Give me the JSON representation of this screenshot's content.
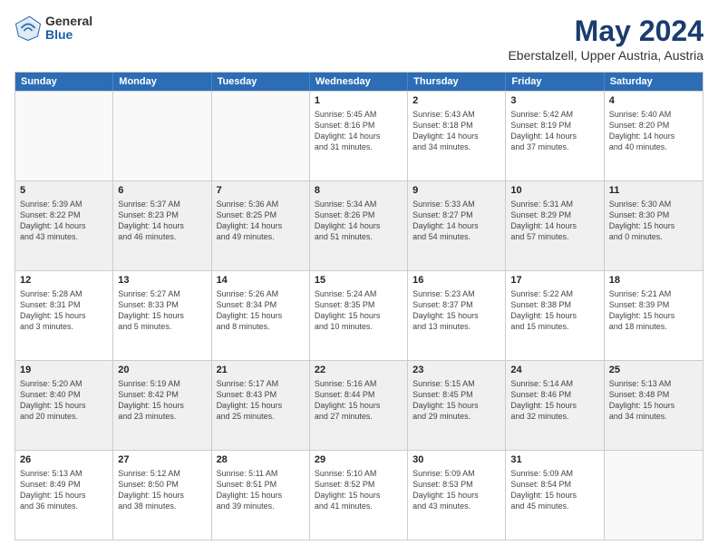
{
  "logo": {
    "general": "General",
    "blue": "Blue"
  },
  "title": "May 2024",
  "subtitle": "Eberstalzell, Upper Austria, Austria",
  "weekdays": [
    "Sunday",
    "Monday",
    "Tuesday",
    "Wednesday",
    "Thursday",
    "Friday",
    "Saturday"
  ],
  "weeks": [
    [
      {
        "day": "",
        "info": ""
      },
      {
        "day": "",
        "info": ""
      },
      {
        "day": "",
        "info": ""
      },
      {
        "day": "1",
        "info": "Sunrise: 5:45 AM\nSunset: 8:16 PM\nDaylight: 14 hours\nand 31 minutes."
      },
      {
        "day": "2",
        "info": "Sunrise: 5:43 AM\nSunset: 8:18 PM\nDaylight: 14 hours\nand 34 minutes."
      },
      {
        "day": "3",
        "info": "Sunrise: 5:42 AM\nSunset: 8:19 PM\nDaylight: 14 hours\nand 37 minutes."
      },
      {
        "day": "4",
        "info": "Sunrise: 5:40 AM\nSunset: 8:20 PM\nDaylight: 14 hours\nand 40 minutes."
      }
    ],
    [
      {
        "day": "5",
        "info": "Sunrise: 5:39 AM\nSunset: 8:22 PM\nDaylight: 14 hours\nand 43 minutes."
      },
      {
        "day": "6",
        "info": "Sunrise: 5:37 AM\nSunset: 8:23 PM\nDaylight: 14 hours\nand 46 minutes."
      },
      {
        "day": "7",
        "info": "Sunrise: 5:36 AM\nSunset: 8:25 PM\nDaylight: 14 hours\nand 49 minutes."
      },
      {
        "day": "8",
        "info": "Sunrise: 5:34 AM\nSunset: 8:26 PM\nDaylight: 14 hours\nand 51 minutes."
      },
      {
        "day": "9",
        "info": "Sunrise: 5:33 AM\nSunset: 8:27 PM\nDaylight: 14 hours\nand 54 minutes."
      },
      {
        "day": "10",
        "info": "Sunrise: 5:31 AM\nSunset: 8:29 PM\nDaylight: 14 hours\nand 57 minutes."
      },
      {
        "day": "11",
        "info": "Sunrise: 5:30 AM\nSunset: 8:30 PM\nDaylight: 15 hours\nand 0 minutes."
      }
    ],
    [
      {
        "day": "12",
        "info": "Sunrise: 5:28 AM\nSunset: 8:31 PM\nDaylight: 15 hours\nand 3 minutes."
      },
      {
        "day": "13",
        "info": "Sunrise: 5:27 AM\nSunset: 8:33 PM\nDaylight: 15 hours\nand 5 minutes."
      },
      {
        "day": "14",
        "info": "Sunrise: 5:26 AM\nSunset: 8:34 PM\nDaylight: 15 hours\nand 8 minutes."
      },
      {
        "day": "15",
        "info": "Sunrise: 5:24 AM\nSunset: 8:35 PM\nDaylight: 15 hours\nand 10 minutes."
      },
      {
        "day": "16",
        "info": "Sunrise: 5:23 AM\nSunset: 8:37 PM\nDaylight: 15 hours\nand 13 minutes."
      },
      {
        "day": "17",
        "info": "Sunrise: 5:22 AM\nSunset: 8:38 PM\nDaylight: 15 hours\nand 15 minutes."
      },
      {
        "day": "18",
        "info": "Sunrise: 5:21 AM\nSunset: 8:39 PM\nDaylight: 15 hours\nand 18 minutes."
      }
    ],
    [
      {
        "day": "19",
        "info": "Sunrise: 5:20 AM\nSunset: 8:40 PM\nDaylight: 15 hours\nand 20 minutes."
      },
      {
        "day": "20",
        "info": "Sunrise: 5:19 AM\nSunset: 8:42 PM\nDaylight: 15 hours\nand 23 minutes."
      },
      {
        "day": "21",
        "info": "Sunrise: 5:17 AM\nSunset: 8:43 PM\nDaylight: 15 hours\nand 25 minutes."
      },
      {
        "day": "22",
        "info": "Sunrise: 5:16 AM\nSunset: 8:44 PM\nDaylight: 15 hours\nand 27 minutes."
      },
      {
        "day": "23",
        "info": "Sunrise: 5:15 AM\nSunset: 8:45 PM\nDaylight: 15 hours\nand 29 minutes."
      },
      {
        "day": "24",
        "info": "Sunrise: 5:14 AM\nSunset: 8:46 PM\nDaylight: 15 hours\nand 32 minutes."
      },
      {
        "day": "25",
        "info": "Sunrise: 5:13 AM\nSunset: 8:48 PM\nDaylight: 15 hours\nand 34 minutes."
      }
    ],
    [
      {
        "day": "26",
        "info": "Sunrise: 5:13 AM\nSunset: 8:49 PM\nDaylight: 15 hours\nand 36 minutes."
      },
      {
        "day": "27",
        "info": "Sunrise: 5:12 AM\nSunset: 8:50 PM\nDaylight: 15 hours\nand 38 minutes."
      },
      {
        "day": "28",
        "info": "Sunrise: 5:11 AM\nSunset: 8:51 PM\nDaylight: 15 hours\nand 39 minutes."
      },
      {
        "day": "29",
        "info": "Sunrise: 5:10 AM\nSunset: 8:52 PM\nDaylight: 15 hours\nand 41 minutes."
      },
      {
        "day": "30",
        "info": "Sunrise: 5:09 AM\nSunset: 8:53 PM\nDaylight: 15 hours\nand 43 minutes."
      },
      {
        "day": "31",
        "info": "Sunrise: 5:09 AM\nSunset: 8:54 PM\nDaylight: 15 hours\nand 45 minutes."
      },
      {
        "day": "",
        "info": ""
      }
    ]
  ]
}
